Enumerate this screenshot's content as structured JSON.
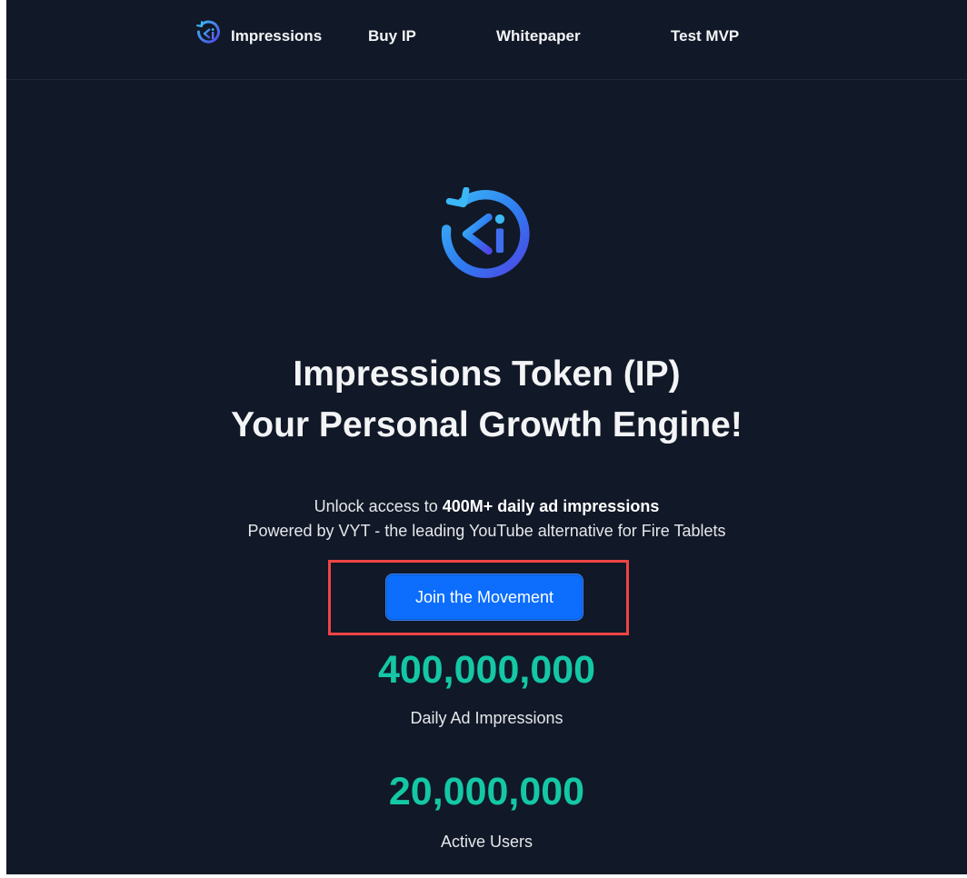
{
  "nav": {
    "brand_label": "Impressions",
    "brand_icon": "impressions-logo-icon",
    "links": [
      "Buy IP",
      "Whitepaper",
      "Test MVP"
    ]
  },
  "hero": {
    "logo_icon": "impressions-logo-icon",
    "headline_line1": "Impressions Token (IP)",
    "headline_line2": "Your Personal Growth Engine!",
    "tagline_prefix": "Unlock access to ",
    "tagline_bold": "400M+ daily ad impressions",
    "tagline_line2": "Powered by VYT - the leading YouTube alternative for Fire Tablets",
    "cta_label": "Join the Movement"
  },
  "stats": [
    {
      "value": "400,000,000",
      "label": "Daily Ad Impressions"
    },
    {
      "value": "20,000,000",
      "label": "Active Users"
    }
  ],
  "colors": {
    "background": "#111827",
    "accent_blue": "#0d6efd",
    "stat_green": "#14c7a5",
    "highlight_red": "#ef4444"
  }
}
